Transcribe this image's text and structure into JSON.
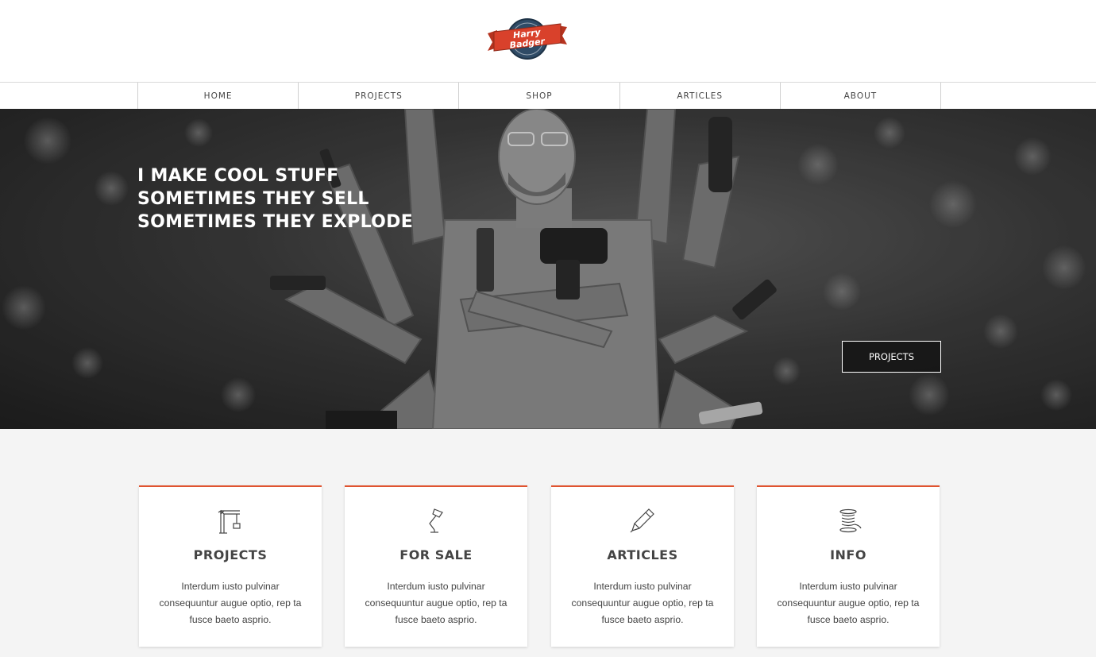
{
  "logo": {
    "text": "Harry Badger",
    "line1": "Harry",
    "line2": "Badger",
    "colors": {
      "red": "#d9412b",
      "navy": "#2f4b66"
    }
  },
  "nav": {
    "items": [
      "HOME",
      "PROJECTS",
      "SHOP",
      "ARTICLES",
      "ABOUT"
    ]
  },
  "hero": {
    "lines": [
      "I MAKE COOL STUFF",
      "SOMETIMES THEY SELL",
      "SOMETIMES THEY EXPLODE"
    ],
    "button_label": "PROJECTS"
  },
  "cards": [
    {
      "title": "PROJECTS",
      "icon": "crane-icon",
      "text": "Interdum iusto pulvinar consequuntur augue optio, rep ta fusce baeto asprio."
    },
    {
      "title": "FOR SALE",
      "icon": "lamp-icon",
      "text": "Interdum iusto pulvinar consequuntur augue optio, rep ta fusce baeto asprio."
    },
    {
      "title": "ARTICLES",
      "icon": "pen-icon",
      "text": "Interdum iusto pulvinar consequuntur augue optio, rep ta fusce baeto asprio."
    },
    {
      "title": "INFO",
      "icon": "spool-icon",
      "text": "Interdum iusto pulvinar consequuntur augue optio, rep ta fusce baeto asprio."
    }
  ],
  "colors": {
    "accent": "#e0532f"
  }
}
